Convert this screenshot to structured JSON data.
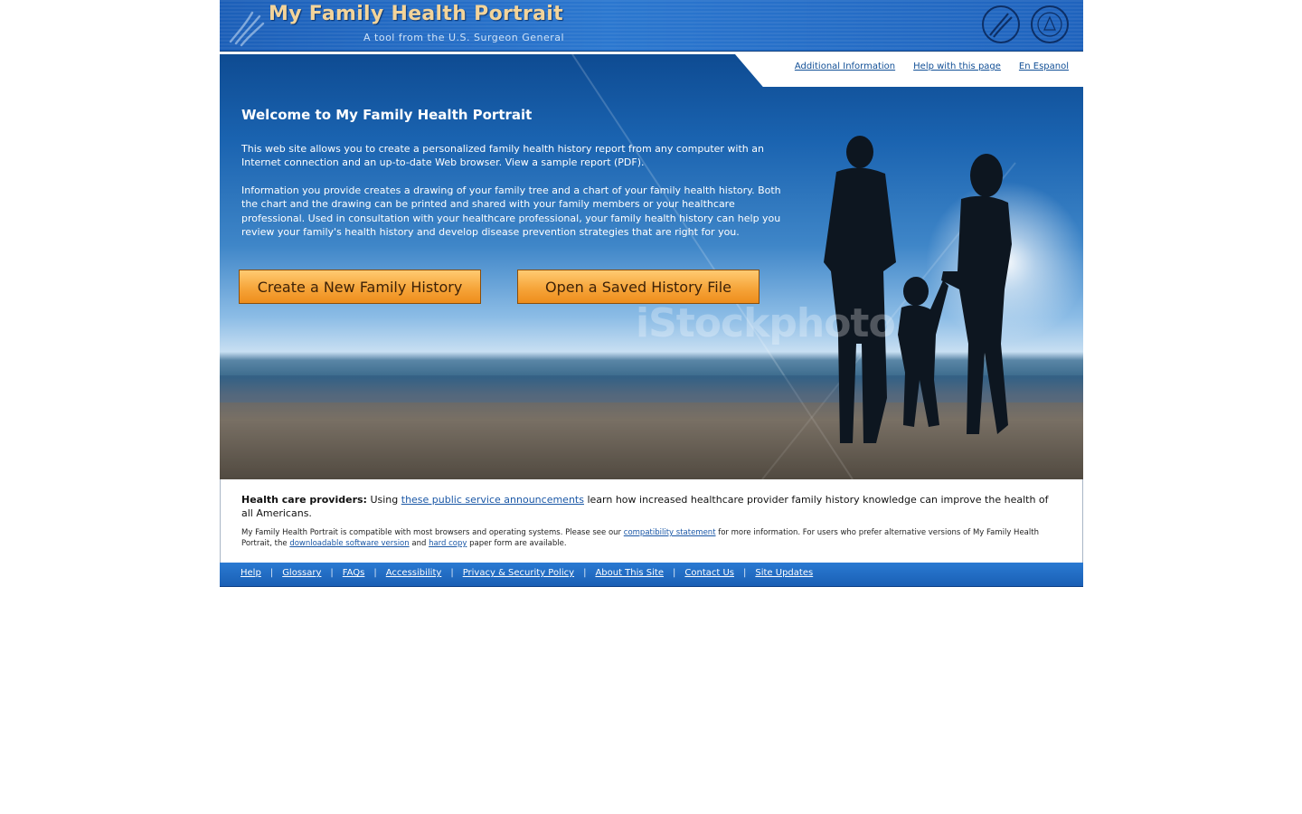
{
  "header": {
    "title": "My Family Health Portrait",
    "subtitle": "A tool from the U.S. Surgeon General"
  },
  "top_links": {
    "additional_info": "Additional Information",
    "help_page": "Help with this page",
    "spanish": "En Espanol"
  },
  "hero": {
    "welcome": "Welcome to My Family Health Portrait",
    "paragraph1": "This web site allows you to create a personalized family health history report from any computer with an Internet connection and an up-to-date Web browser. View a sample report (PDF).",
    "paragraph2": "Information you provide creates a drawing of your family tree and a chart of your family health history. Both the chart and the drawing can be printed and shared with your family members or your healthcare professional. Used in consultation with your healthcare professional, your family health history can help you review your family's health history and develop disease prevention strategies that are right for you.",
    "watermark": "iStockphoto",
    "buttons": {
      "create": "Create a New Family History",
      "open": "Open a Saved History File"
    }
  },
  "info": {
    "providers_label": "Health care providers:",
    "providers_pre": "Using",
    "providers_link": "these public service announcements",
    "providers_post": "learn how increased healthcare provider family history knowledge can improve the health of all Americans.",
    "compat_pre": "My Family Health Portrait is compatible with most browsers and operating systems. Please see our",
    "compat_link": "compatibility statement",
    "compat_mid": "for more information. For users who prefer alternative versions of My Family Health Portrait, the",
    "download_link": "downloadable software version",
    "and_text": "and",
    "hardcopy_link": "hard copy",
    "compat_post": "paper form are available."
  },
  "footer": {
    "links": [
      "Help",
      "Glossary",
      "FAQs",
      "Accessibility",
      "Privacy & Security Policy",
      "About This Site",
      "Contact Us",
      "Site Updates"
    ],
    "separator": "|"
  },
  "colors": {
    "banner_blue": "#1c5fb8",
    "title_gold": "#f3d49a",
    "button_orange": "#f6a53a",
    "link_blue": "#1a57a6"
  },
  "icons": [
    "hhs-logo-icon",
    "hhs-seal-icon",
    "surgeon-general-seal-icon"
  ]
}
